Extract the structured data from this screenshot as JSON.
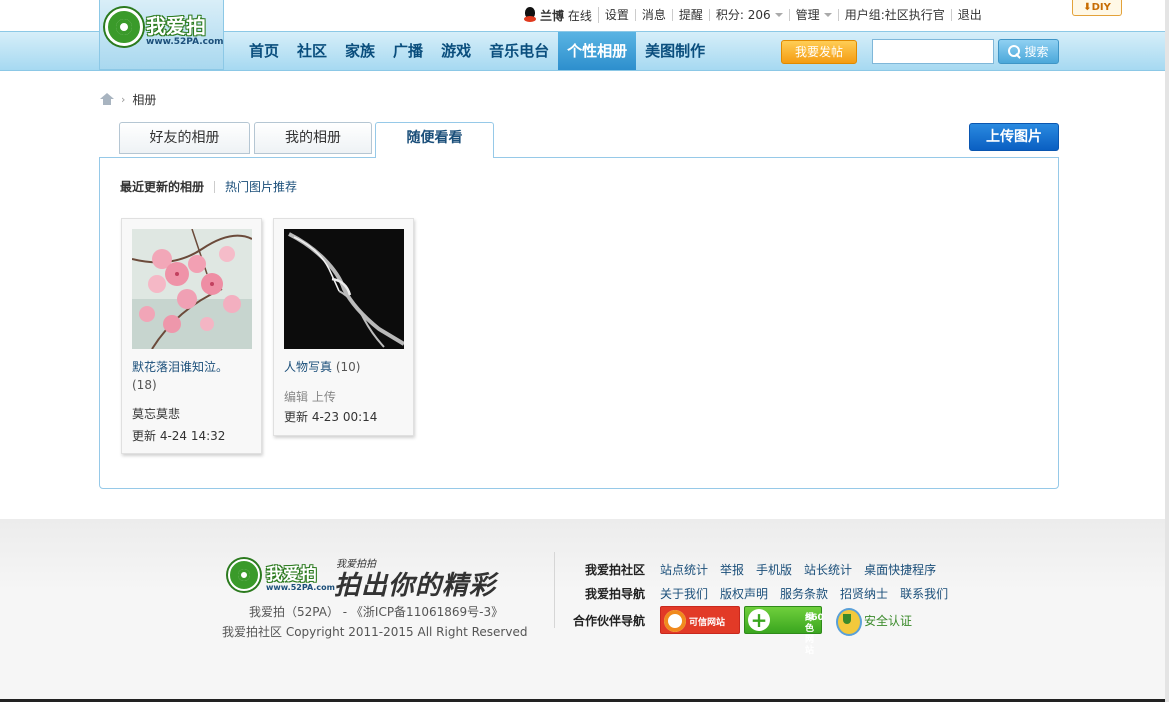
{
  "logo": {
    "text": "我爱拍",
    "url": "www.52PA.com"
  },
  "userbar": {
    "username": "兰博",
    "status": "在线",
    "links": [
      "设置",
      "消息",
      "提醒"
    ],
    "points_label": "积分: 206",
    "manage_label": "管理",
    "group_label": "用户组:社区执行官",
    "logout_label": "退出"
  },
  "diy": {
    "label": "DIY"
  },
  "nav": {
    "items": [
      "首页",
      "社区",
      "家族",
      "广播",
      "游戏",
      "音乐电台",
      "个性相册",
      "美图制作"
    ],
    "active": "个性相册",
    "post_label": "我要发帖",
    "search_placeholder": "",
    "search_label": "搜索"
  },
  "breadcrumb": {
    "current": "相册"
  },
  "tabs": {
    "items": [
      "好友的相册",
      "我的相册",
      "随便看看"
    ],
    "active": "随便看看",
    "upload_label": "上传图片"
  },
  "subtabs": {
    "current": "最近更新的相册",
    "link": "热门图片推荐"
  },
  "albums": [
    {
      "title": "默花落泪谁知泣。",
      "count": "(18)",
      "owner": "莫忘莫悲",
      "actions": "",
      "updated": "更新 4-24 14:32",
      "thumb": "pink-blossom-thumbnail"
    },
    {
      "title": "人物写真",
      "count": "(10)",
      "owner": "",
      "actions": "编辑 上传",
      "updated": "更新 4-23 00:14",
      "thumb": "smoke-thumbnail"
    }
  ],
  "footer": {
    "slogan_small": "我爱拍拍",
    "slogan": "拍出你的精彩",
    "line1": "我爱拍（52PA） -  《浙ICP备11061869号-3》",
    "line2": "我爱拍社区   Copyright 2011-2015 All Right Reserved",
    "rows": [
      {
        "label": "我爱拍社区",
        "links": [
          "站点统计",
          "举报",
          "手机版",
          "站长统计",
          "桌面快捷程序"
        ]
      },
      {
        "label": "我爱拍导航",
        "links": [
          "关于我们",
          "版权声明",
          "服务条款",
          "招贤纳士",
          "联系我们"
        ]
      },
      {
        "label": "合作伙伴导航",
        "links": []
      }
    ],
    "badge_trust": "可信网站",
    "badge_360_line1": "360",
    "badge_360_line2": "绿色网站",
    "safe_label": "安全认证"
  }
}
